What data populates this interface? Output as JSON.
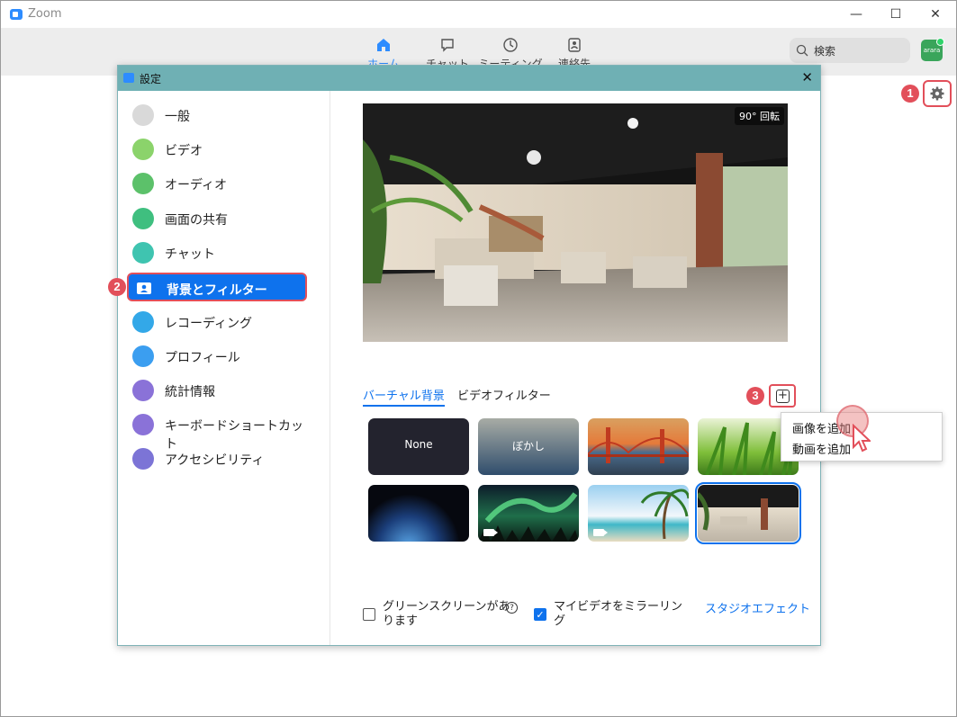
{
  "window": {
    "title": "Zoom",
    "controls": {
      "minimize": "—",
      "maximize": "☐",
      "close": "✕"
    }
  },
  "toolbar": {
    "tabs": [
      {
        "label": "ホーム",
        "icon": "home-icon",
        "active": true
      },
      {
        "label": "チャット",
        "icon": "chat-icon",
        "active": false
      },
      {
        "label": "ミーティング",
        "icon": "clock-icon",
        "active": false
      },
      {
        "label": "連絡先",
        "icon": "contact-icon",
        "active": false
      }
    ],
    "search_label": "検索",
    "avatar_text": "arara"
  },
  "markers": {
    "m1": "1",
    "m2": "2",
    "m3": "3"
  },
  "settings": {
    "title": "設定",
    "close": "✕",
    "nav": [
      {
        "label": "一般",
        "icon": "gear-icon",
        "color": "#d9d9d9"
      },
      {
        "label": "ビデオ",
        "icon": "video-icon",
        "color": "#8bd36b"
      },
      {
        "label": "オーディオ",
        "icon": "headphones-icon",
        "color": "#5cc16a"
      },
      {
        "label": "画面の共有",
        "icon": "share-screen-icon",
        "color": "#3fbf7f"
      },
      {
        "label": "チャット",
        "icon": "chat-icon",
        "color": "#3fc4b0"
      },
      {
        "label": "背景とフィルター",
        "icon": "background-icon",
        "color": "#0e72ed",
        "active": true
      },
      {
        "label": "レコーディング",
        "icon": "record-icon",
        "color": "#33a8e8"
      },
      {
        "label": "プロフィール",
        "icon": "profile-icon",
        "color": "#3b9ef0"
      },
      {
        "label": "統計情報",
        "icon": "statistics-icon",
        "color": "#8a72d8"
      },
      {
        "label": "キーボードショートカット",
        "icon": "keyboard-icon",
        "color": "#8a72d8"
      },
      {
        "label": "アクセシビリティ",
        "icon": "accessibility-icon",
        "color": "#7c74d6"
      }
    ],
    "preview": {
      "rotate_label": "90° 回転"
    },
    "tabs": {
      "virtual": "バーチャル背景",
      "filter": "ビデオフィルター"
    },
    "thumbnails": [
      {
        "label": "None"
      },
      {
        "label": "ぼかし"
      },
      {
        "label": ""
      },
      {
        "label": ""
      },
      {
        "label": ""
      },
      {
        "label": ""
      },
      {
        "label": ""
      },
      {
        "label": ""
      }
    ],
    "green_screen": {
      "label_line1": "グリーンスクリーンがあ",
      "label_line2": "ります",
      "checked": false
    },
    "mirror": {
      "label_line1": "マイビデオをミラーリン",
      "label_line2": "グ",
      "checked": true,
      "check_glyph": "✓"
    },
    "studio_effects": "スタジオエフェクト",
    "add_symbol": "+",
    "help_symbol": "?"
  },
  "context_menu": {
    "items": [
      "画像を追加",
      "動画を追加"
    ]
  }
}
